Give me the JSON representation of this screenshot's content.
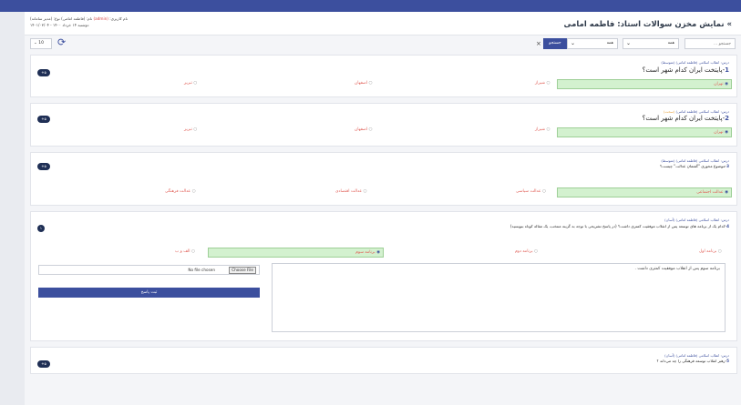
{
  "header": {
    "title": "» نمایش مخزن سوالات استاد: فاطمه امامی",
    "user_prefix": "نام کاربری: ",
    "user_role": "(admin)",
    "user_rest": " نام: (فاطمه امامی) نوع: (مدیر سامانه)",
    "date": "دوشنبه ۱۴ خرداد ۱۴۰۰ - ۱۴۰۱/۰۳/۰۴"
  },
  "toolbar": {
    "search_placeholder": "جستجو ...",
    "select1_value": "همه",
    "select2_value": "همه",
    "search_button": "جستجو",
    "clear_icon": "×",
    "per_page": "10",
    "refresh_icon": "refresh-icon"
  },
  "questions": [
    {
      "meta_prefix": "درس: انقلاب اسلامی (فاطمه امامی) ",
      "level": "(متوسط)",
      "number": "1",
      "text": "-پایتخت ایران کدام شهر است؟",
      "badge": "+۵",
      "options": [
        "تهران",
        "شیراز",
        "اصفهان",
        "تبریز"
      ]
    },
    {
      "meta_prefix": "درس: انقلاب اسلامی (فاطمه امامی) ",
      "level": "(سخت)",
      "number": "2",
      "text": "-پایتخت ایران کدام شهر است؟",
      "badge": "+۵",
      "options": [
        "تهران",
        "شیراز",
        "اصفهان",
        "تبریز"
      ]
    },
    {
      "meta_prefix": "درس: انقلاب اسلامی (فاطمه امامی) ",
      "level": "(متوسط)",
      "number": "3",
      "text": "-موضوع محوری \"گفتمان عدالت\" چیست؟",
      "badge": "+۵",
      "options": [
        "عدالت اجتماعی",
        "عدالت سیاسی",
        "عدالت اقتصادی",
        "عدالت فرهنگی"
      ]
    },
    {
      "meta_prefix": "درس: انقلاب اسلامی (فاطمه امامی) ",
      "level": "(آسان)",
      "number": "4",
      "text": "-کدام یک از برنامه های توسعه پس از انقلاب موفقیت کمتری داشت؟ (در پاسخ تشریحی با توجه به گزینه منتخب، یک مقاله کوتاه بنویسید)",
      "badge": "۱",
      "options": [
        "برنامه اول",
        "برنامه دوم",
        "برنامه سوم",
        "الف و ب"
      ],
      "answer_text": "برنامه سوم پس از انقلاب موفقیت کمتری داشت .",
      "file_label": "No file chosen",
      "file_button": "Choose File",
      "submit_label": "ثبت پاسخ"
    },
    {
      "meta_prefix": "درس: انقلاب اسلامی (فاطمه امامی) ",
      "level": "(آسان)",
      "number": "5",
      "text": "-رهبر انقلاب توسعه فرهنگی را چه می‌داند ؟",
      "badge": "+۵"
    }
  ],
  "colors": {
    "primary": "#3c4f9e",
    "correct_bg": "#d3f1cf",
    "option_text": "#e05a52",
    "badge": "#1f2f55"
  }
}
